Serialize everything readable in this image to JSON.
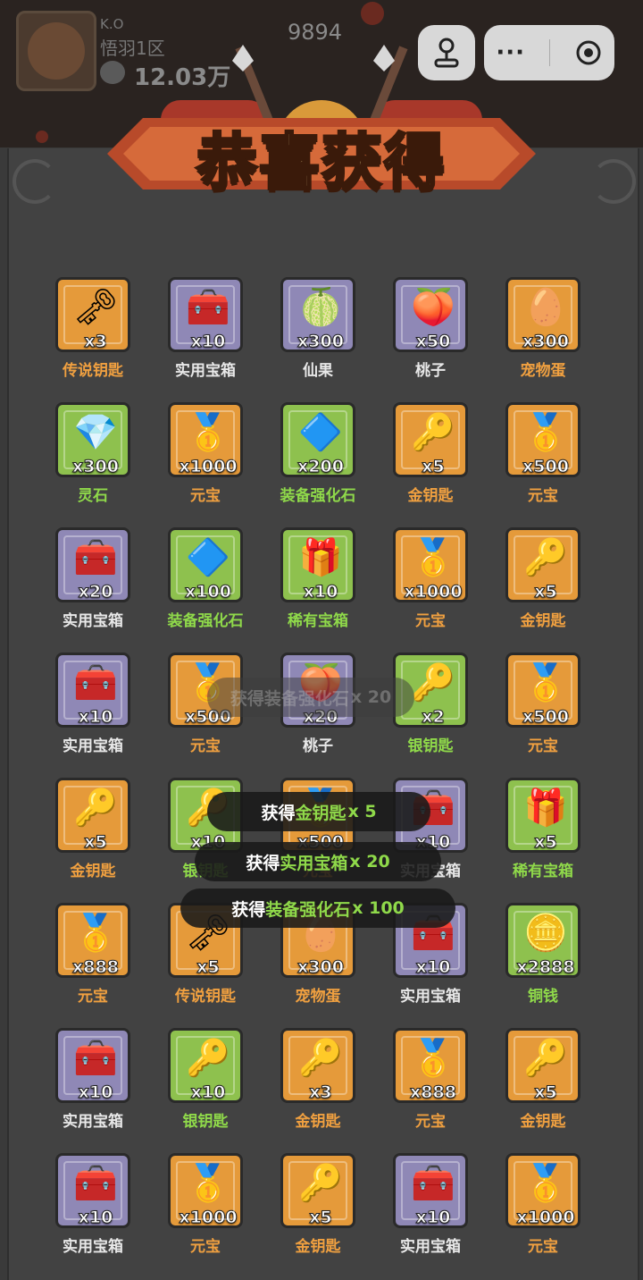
{
  "hud": {
    "level": "K.O",
    "player_name": "悟羽1区",
    "power": "12.03万",
    "coins": "9894"
  },
  "capsule": {
    "more_label": "···"
  },
  "banner": {
    "title": "恭喜获得"
  },
  "colors": {
    "orange": "#e59a3a",
    "purple": "#8f88b6",
    "green": "#8ec14e",
    "panel": "#424242"
  },
  "rewards": [
    {
      "name": "传说钥匙",
      "qty": "x3",
      "rarity": "orange",
      "icon": "legend-key-icon",
      "glyph": "🗝"
    },
    {
      "name": "实用宝箱",
      "qty": "x10",
      "rarity": "purple",
      "icon": "chest-icon",
      "glyph": "🧰"
    },
    {
      "name": "仙果",
      "qty": "x300",
      "rarity": "purple",
      "icon": "immortal-fruit-icon",
      "glyph": "🍈"
    },
    {
      "name": "桃子",
      "qty": "x50",
      "rarity": "purple",
      "icon": "peach-icon",
      "glyph": "🍑"
    },
    {
      "name": "宠物蛋",
      "qty": "x300",
      "rarity": "orange",
      "icon": "pet-egg-icon",
      "glyph": "🥚"
    },
    {
      "name": "灵石",
      "qty": "x300",
      "rarity": "green",
      "icon": "spirit-stone-icon",
      "glyph": "💎"
    },
    {
      "name": "元宝",
      "qty": "x1000",
      "rarity": "orange",
      "icon": "gold-ingot-icon",
      "glyph": "🥇"
    },
    {
      "name": "装备强化石",
      "qty": "x200",
      "rarity": "green",
      "icon": "crystal-icon",
      "glyph": "🔷"
    },
    {
      "name": "金钥匙",
      "qty": "x5",
      "rarity": "orange",
      "icon": "gold-key-icon",
      "glyph": "🔑"
    },
    {
      "name": "元宝",
      "qty": "x500",
      "rarity": "orange",
      "icon": "gold-ingot-icon",
      "glyph": "🥇"
    },
    {
      "name": "实用宝箱",
      "qty": "x20",
      "rarity": "purple",
      "icon": "chest-icon",
      "glyph": "🧰"
    },
    {
      "name": "装备强化石",
      "qty": "x100",
      "rarity": "green",
      "icon": "crystal-icon",
      "glyph": "🔷"
    },
    {
      "name": "稀有宝箱",
      "qty": "x10",
      "rarity": "green",
      "icon": "rare-chest-icon",
      "glyph": "🎁"
    },
    {
      "name": "元宝",
      "qty": "x1000",
      "rarity": "orange",
      "icon": "gold-ingot-icon",
      "glyph": "🥇"
    },
    {
      "name": "金钥匙",
      "qty": "x5",
      "rarity": "orange",
      "icon": "gold-key-icon",
      "glyph": "🔑"
    },
    {
      "name": "实用宝箱",
      "qty": "x10",
      "rarity": "purple",
      "icon": "chest-icon",
      "glyph": "🧰"
    },
    {
      "name": "元宝",
      "qty": "x500",
      "rarity": "orange",
      "icon": "gold-ingot-icon",
      "glyph": "🥇"
    },
    {
      "name": "桃子",
      "qty": "x20",
      "rarity": "purple",
      "icon": "peach-icon",
      "glyph": "🍑"
    },
    {
      "name": "银钥匙",
      "qty": "x2",
      "rarity": "green",
      "icon": "silver-key-icon",
      "glyph": "🔑"
    },
    {
      "name": "元宝",
      "qty": "x500",
      "rarity": "orange",
      "icon": "gold-ingot-icon",
      "glyph": "🥇"
    },
    {
      "name": "金钥匙",
      "qty": "x5",
      "rarity": "orange",
      "icon": "gold-key-icon",
      "glyph": "🔑"
    },
    {
      "name": "银钥匙",
      "qty": "x10",
      "rarity": "green",
      "icon": "silver-key-icon",
      "glyph": "🔑"
    },
    {
      "name": "元宝",
      "qty": "x500",
      "rarity": "orange",
      "icon": "gold-ingot-icon",
      "glyph": "🥇"
    },
    {
      "name": "实用宝箱",
      "qty": "x10",
      "rarity": "purple",
      "icon": "chest-icon",
      "glyph": "🧰"
    },
    {
      "name": "稀有宝箱",
      "qty": "x5",
      "rarity": "green",
      "icon": "rare-chest-icon",
      "glyph": "🎁"
    },
    {
      "name": "元宝",
      "qty": "x888",
      "rarity": "orange",
      "icon": "gold-ingot-icon",
      "glyph": "🥇"
    },
    {
      "name": "传说钥匙",
      "qty": "x5",
      "rarity": "orange",
      "icon": "legend-key-icon",
      "glyph": "🗝"
    },
    {
      "name": "宠物蛋",
      "qty": "x300",
      "rarity": "orange",
      "icon": "pet-egg-icon",
      "glyph": "🥚"
    },
    {
      "name": "实用宝箱",
      "qty": "x10",
      "rarity": "purple",
      "icon": "chest-icon",
      "glyph": "🧰"
    },
    {
      "name": "铜钱",
      "qty": "x2888",
      "rarity": "green",
      "icon": "copper-coin-icon",
      "glyph": "🪙"
    },
    {
      "name": "实用宝箱",
      "qty": "x10",
      "rarity": "purple",
      "icon": "chest-icon",
      "glyph": "🧰"
    },
    {
      "name": "银钥匙",
      "qty": "x10",
      "rarity": "green",
      "icon": "silver-key-icon",
      "glyph": "🔑"
    },
    {
      "name": "金钥匙",
      "qty": "x3",
      "rarity": "orange",
      "icon": "gold-key-icon",
      "glyph": "🔑"
    },
    {
      "name": "元宝",
      "qty": "x888",
      "rarity": "orange",
      "icon": "gold-ingot-icon",
      "glyph": "🥇"
    },
    {
      "name": "金钥匙",
      "qty": "x5",
      "rarity": "orange",
      "icon": "gold-key-icon",
      "glyph": "🔑"
    },
    {
      "name": "实用宝箱",
      "qty": "x10",
      "rarity": "purple",
      "icon": "chest-icon",
      "glyph": "🧰"
    },
    {
      "name": "元宝",
      "qty": "x1000",
      "rarity": "orange",
      "icon": "gold-ingot-icon",
      "glyph": "🥇"
    },
    {
      "name": "金钥匙",
      "qty": "x5",
      "rarity": "orange",
      "icon": "gold-key-icon",
      "glyph": "🔑"
    },
    {
      "name": "实用宝箱",
      "qty": "x10",
      "rarity": "purple",
      "icon": "chest-icon",
      "glyph": "🧰"
    },
    {
      "name": "元宝",
      "qty": "x1000",
      "rarity": "orange",
      "icon": "gold-ingot-icon",
      "glyph": "🥇"
    }
  ],
  "toasts": [
    {
      "verb": "获得",
      "item": "装备强化石",
      "qty": "x 20",
      "faded": true
    },
    {
      "verb": "获得",
      "item": "金钥匙",
      "qty": "x 5",
      "faded": false
    },
    {
      "verb": "获得",
      "item": "实用宝箱",
      "qty": "x 20",
      "faded": false
    },
    {
      "verb": "获得",
      "item": "装备强化石",
      "qty": "x 100",
      "faded": false
    }
  ]
}
